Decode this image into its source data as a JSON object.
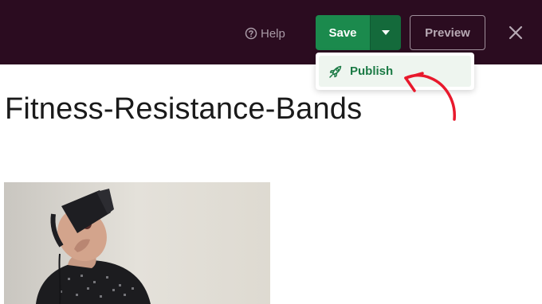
{
  "toolbar": {
    "help_label": "Help",
    "save_label": "Save",
    "preview_label": "Preview",
    "icons": {
      "help": "question-circle-icon",
      "save_menu": "caret-down-icon",
      "close": "close-icon"
    }
  },
  "save_menu": {
    "items": [
      {
        "label": "Publish",
        "icon": "rocket-icon"
      }
    ]
  },
  "page": {
    "title": "Fitness-Resistance-Bands"
  },
  "colors": {
    "topbar": "#2b0c20",
    "save": "#1b8a4d",
    "save_dark": "#146a3b",
    "publish_text": "#1b7a45",
    "annotation_arrow": "#e8192c"
  }
}
